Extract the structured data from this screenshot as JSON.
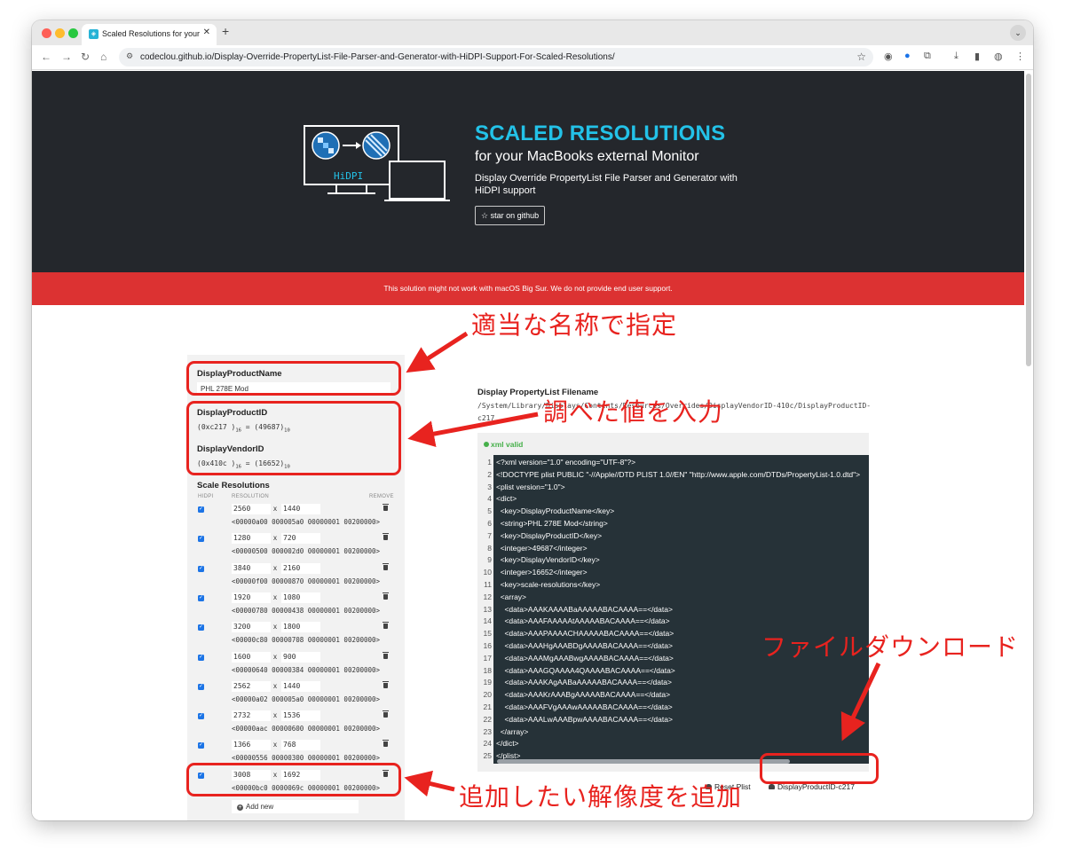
{
  "browser": {
    "tab_title": "Scaled Resolutions for your M",
    "url": "codeclou.github.io/Display-Override-PropertyList-File-Parser-and-Generator-with-HiDPI-Support-For-Scaled-Resolutions/"
  },
  "hero": {
    "logo_text": "HiDPI",
    "title": "SCALED RESOLUTIONS",
    "subtitle": "for your MacBooks external Monitor",
    "description": "Display Override PropertyList File Parser and Generator with HiDPI support",
    "star_button": "☆ star on github"
  },
  "warning": "This solution might not work with macOS Big Sur. We do not provide end user support.",
  "form": {
    "product_name_label": "DisplayProductName",
    "product_name_value": "PHL 278E Mod",
    "product_id_label": "DisplayProductID",
    "product_id_hex": "c217",
    "product_id_dec": "49687",
    "vendor_id_label": "DisplayVendorID",
    "vendor_id_hex": "410c",
    "vendor_id_dec": "16652",
    "scale_label": "Scale Resolutions",
    "col_hidpi": "HIDPI",
    "col_resolution": "RESOLUTION",
    "col_remove": "REMOVE",
    "add_new": "Add new",
    "resolutions": [
      {
        "w": "2560",
        "h": "1440",
        "code": "<00000a00 000005a0 00000001 00200000>"
      },
      {
        "w": "1280",
        "h": "720",
        "code": "<00000500 000002d0 00000001 00200000>"
      },
      {
        "w": "3840",
        "h": "2160",
        "code": "<00000f00 00000870 00000001 00200000>"
      },
      {
        "w": "1920",
        "h": "1080",
        "code": "<00000780 00000438 00000001 00200000>"
      },
      {
        "w": "3200",
        "h": "1800",
        "code": "<00000c80 00000708 00000001 00200000>"
      },
      {
        "w": "1600",
        "h": "900",
        "code": "<00000640 00000384 00000001 00200000>"
      },
      {
        "w": "2562",
        "h": "1440",
        "code": "<00000a02 000005a0 00000001 00200000>"
      },
      {
        "w": "2732",
        "h": "1536",
        "code": "<00000aac 00000600 00000001 00200000>"
      },
      {
        "w": "1366",
        "h": "768",
        "code": "<00000556 00000300 00000001 00200000>"
      },
      {
        "w": "3008",
        "h": "1692",
        "code": "<00000bc0 0000069c 00000001 00200000>"
      }
    ]
  },
  "plist": {
    "filename_label": "Display PropertyList Filename",
    "filename": "/System/Library/Displays/Contents/Resources/Overrides/DisplayVendorID-410c/DisplayProductID-c217",
    "xml_valid": "xml valid",
    "lines": [
      "<?xml version=\"1.0\" encoding=\"UTF-8\"?>",
      "<!DOCTYPE plist PUBLIC \"-//Apple//DTD PLIST 1.0//EN\" \"http://www.apple.com/DTDs/PropertyList-1.0.dtd\">",
      "<plist version=\"1.0\">",
      "<dict>",
      "  <key>DisplayProductName</key>",
      "  <string>PHL 278E Mod</string>",
      "  <key>DisplayProductID</key>",
      "  <integer>49687</integer>",
      "  <key>DisplayVendorID</key>",
      "  <integer>16652</integer>",
      "  <key>scale-resolutions</key>",
      "  <array>",
      "    <data>AAAKAAAABaAAAAABACAAAA==</data>",
      "    <data>AAAFAAAAAtAAAAABACAAAA==</data>",
      "    <data>AAAPAAAACHAAAAABACAAAA==</data>",
      "    <data>AAAHgAAABDgAAAABACAAAA==</data>",
      "    <data>AAAMgAAABwgAAAABACAAAA==</data>",
      "    <data>AAAGQAAAA4QAAAABACAAAA==</data>",
      "    <data>AAAKAgAABaAAAAABACAAAA==</data>",
      "    <data>AAAKrAAABgAAAAABACAAAA==</data>",
      "    <data>AAAFVgAAAwAAAAABACAAAA==</data>",
      "    <data>AAALwAAABpwAAAABACAAAA==</data>",
      "  </array>",
      "</dict>",
      "</plist>"
    ],
    "reset_button": "Reset Plist",
    "download_button": "DisplayProductID-c217"
  },
  "annotations": {
    "name_note": "適当な名称で指定",
    "id_note": "調べた値を入力",
    "download_note": "ファイルダウンロード",
    "add_note": "追加したい解像度を追加"
  },
  "colors": {
    "hero_bg": "#24272c",
    "accent": "#23c2e8",
    "warning_bg": "#dc3232",
    "annotation_red": "#e8231f",
    "editor_bg": "#263238"
  }
}
